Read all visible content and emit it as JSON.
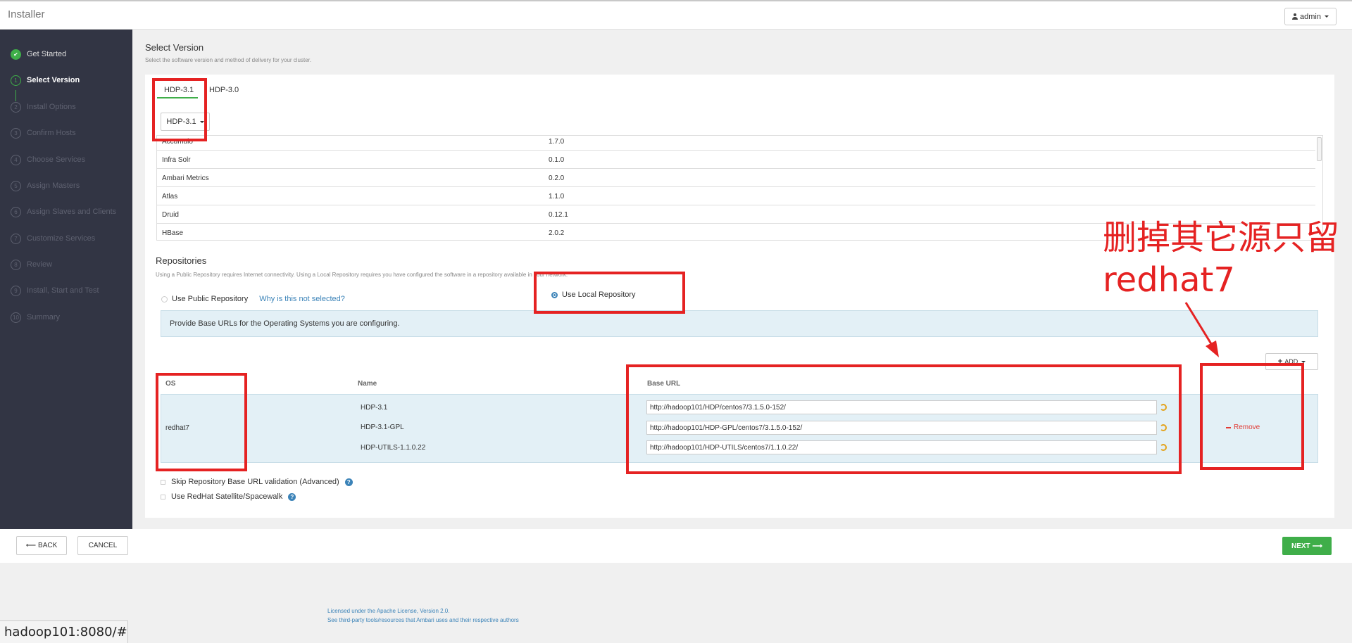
{
  "app": {
    "title": "Installer",
    "user_label": "admin"
  },
  "sidebar": {
    "steps": [
      {
        "num": "",
        "label": "Get Started",
        "state": "done"
      },
      {
        "num": "1",
        "label": "Select Version",
        "state": "current"
      },
      {
        "num": "2",
        "label": "Install Options",
        "state": "pending"
      },
      {
        "num": "3",
        "label": "Confirm Hosts",
        "state": "pending"
      },
      {
        "num": "4",
        "label": "Choose Services",
        "state": "pending"
      },
      {
        "num": "5",
        "label": "Assign Masters",
        "state": "pending"
      },
      {
        "num": "6",
        "label": "Assign Slaves and Clients",
        "state": "pending"
      },
      {
        "num": "7",
        "label": "Customize Services",
        "state": "pending"
      },
      {
        "num": "8",
        "label": "Review",
        "state": "pending"
      },
      {
        "num": "9",
        "label": "Install, Start and Test",
        "state": "pending"
      },
      {
        "num": "10",
        "label": "Summary",
        "state": "pending"
      }
    ]
  },
  "main": {
    "title": "Select Version",
    "subtitle": "Select the software version and method of delivery for your cluster.",
    "tabs": [
      {
        "label": "HDP-3.1",
        "active": true
      },
      {
        "label": "HDP-3.0",
        "active": false
      }
    ],
    "version_select": "HDP-3.1",
    "stack_rows": [
      {
        "name": "Accumulo",
        "version": "1.7.0"
      },
      {
        "name": "Infra Solr",
        "version": "0.1.0"
      },
      {
        "name": "Ambari Metrics",
        "version": "0.2.0"
      },
      {
        "name": "Atlas",
        "version": "1.1.0"
      },
      {
        "name": "Druid",
        "version": "0.12.1"
      },
      {
        "name": "HBase",
        "version": "2.0.2"
      }
    ]
  },
  "repositories": {
    "title": "Repositories",
    "subtitle": "Using a Public Repository requires Internet connectivity. Using a Local Repository requires you have configured the software in a repository available in your network.",
    "public_label": "Use Public Repository",
    "why_link": "Why is this not selected?",
    "local_label": "Use Local Repository",
    "info": "Provide Base URLs for the Operating Systems you are configuring.",
    "add_label": "ADD",
    "headers": {
      "os": "OS",
      "name": "Name",
      "base_url": "Base URL"
    },
    "os": "redhat7",
    "rows": [
      {
        "name": "HDP-3.1",
        "url": "http://hadoop101/HDP/centos7/3.1.5.0-152/"
      },
      {
        "name": "HDP-3.1-GPL",
        "url": "http://hadoop101/HDP-GPL/centos7/3.1.5.0-152/"
      },
      {
        "name": "HDP-UTILS-1.1.0.22",
        "url": "http://hadoop101/HDP-UTILS/centos7/1.1.0.22/"
      }
    ],
    "remove_label": "Remove",
    "skip_label": "Skip Repository Base URL validation (Advanced)",
    "satellite_label": "Use RedHat Satellite/Spacewalk"
  },
  "footer": {
    "back_label": "BACK",
    "cancel_label": "CANCEL",
    "next_label": "NEXT",
    "license_line1": "Licensed under the Apache License, Version 2.0.",
    "license_line2": "See third-party tools/resources that Ambari uses and their respective authors"
  },
  "statusbar": {
    "url": "hadoop101:8080/#"
  },
  "annotation": {
    "text": "删掉其它源只留redhat7"
  },
  "colors": {
    "accent_green": "#3fae49",
    "sidebar_bg": "#323544",
    "annotation_red": "#e52222",
    "link_blue": "#3b83b8"
  }
}
